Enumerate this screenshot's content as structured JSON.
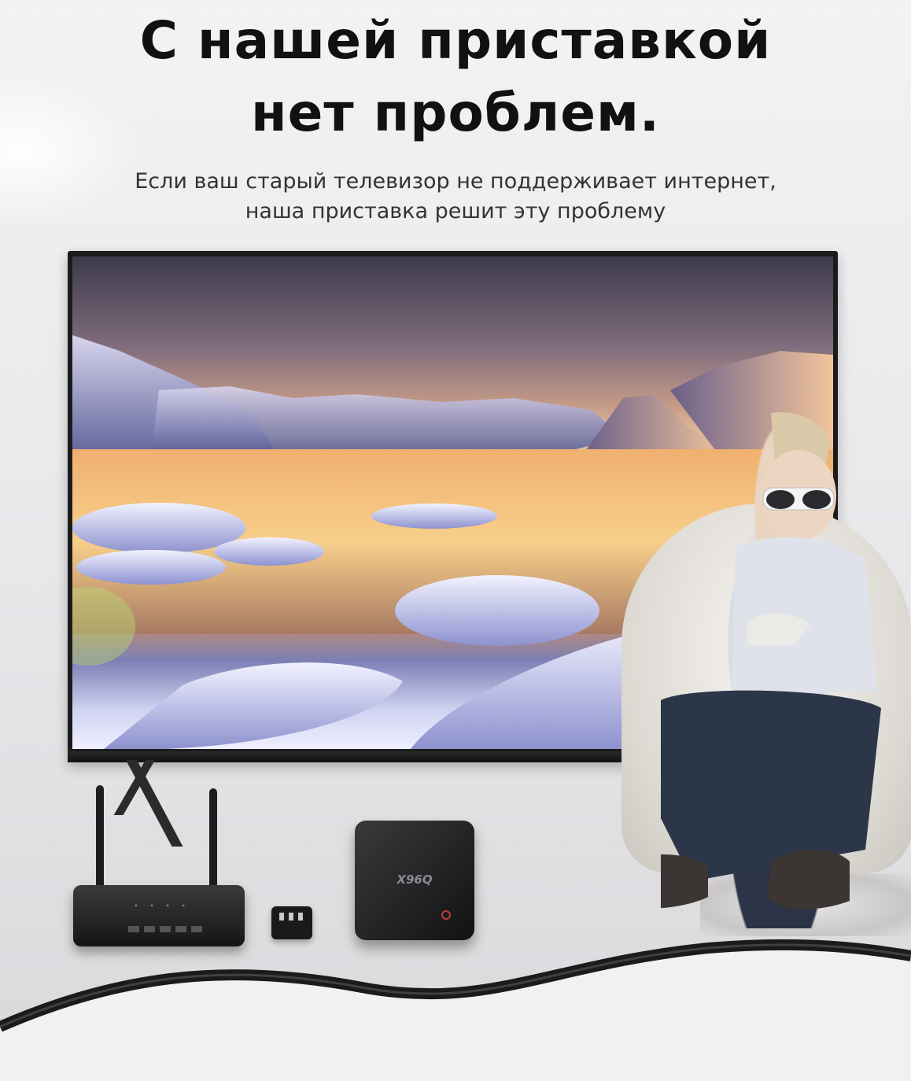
{
  "header": {
    "title_line1": "С нашей приставкой",
    "title_line2": "нет проблем.",
    "subtitle_line1": "Если ваш старый телевизор не поддерживает интернет,",
    "subtitle_line2": "наша приставка решит эту проблему"
  },
  "product": {
    "box_label": "X96Q"
  }
}
